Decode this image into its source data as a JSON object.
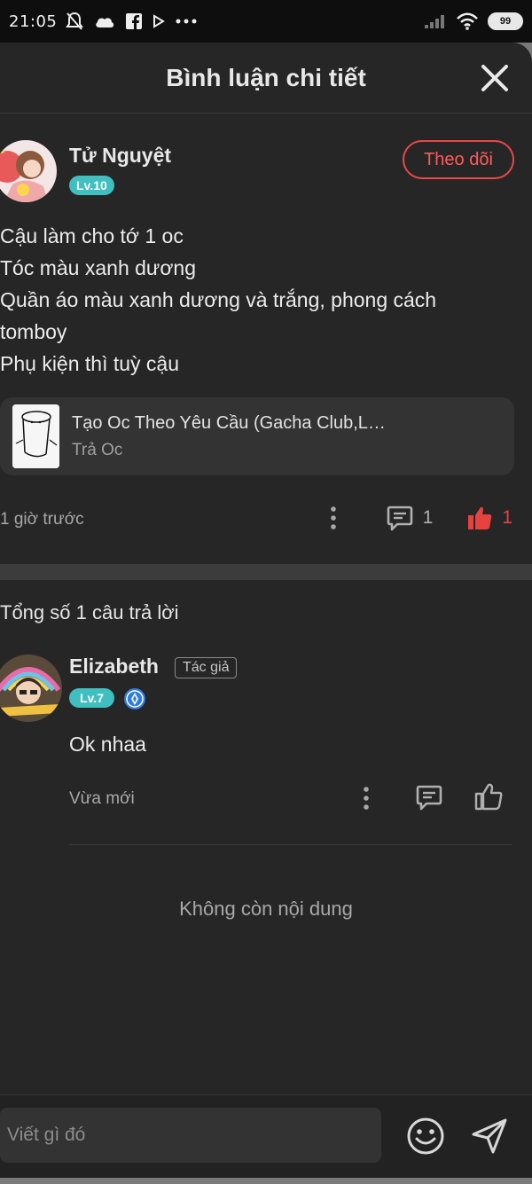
{
  "status_bar": {
    "time": "21:05",
    "battery": "99"
  },
  "header": {
    "title": "Bình luận chi tiết"
  },
  "comment": {
    "author": "Tử Nguyệt",
    "level": "Lv.10",
    "follow_label": "Theo dõi",
    "lines": [
      "Cậu làm cho tớ 1 oc",
      "Tóc màu xanh dương",
      "Quần áo màu xanh dương và trắng, phong cách",
      "tomboy",
      "Phụ kiện thì tuỳ cậu"
    ],
    "attachment": {
      "title": "Tạo Oc Theo Yêu Cầu (Gacha Club,L…",
      "subtitle": "Trả Oc"
    },
    "time": "1 giờ trước",
    "reply_count": "1",
    "like_count": "1"
  },
  "replies_section": {
    "total_label": "Tổng số 1 câu trả lời",
    "items": [
      {
        "author": "Elizabeth",
        "author_tag": "Tác giả",
        "level": "Lv.7",
        "text": "Ok nhaa",
        "time": "Vừa mới"
      }
    ],
    "end_label": "Không còn nội dung"
  },
  "composer": {
    "placeholder": "Viết gì đó"
  },
  "colors": {
    "accent_red": "#e84848",
    "level_teal": "#3fbfbf",
    "sheet_bg": "#262626"
  },
  "icons": {
    "close": "close-icon",
    "more": "more-vertical-icon",
    "reply": "comment-icon",
    "like": "thumbs-up-icon",
    "emoji": "smiley-icon",
    "send": "send-icon",
    "verified": "verified-badge-icon"
  }
}
